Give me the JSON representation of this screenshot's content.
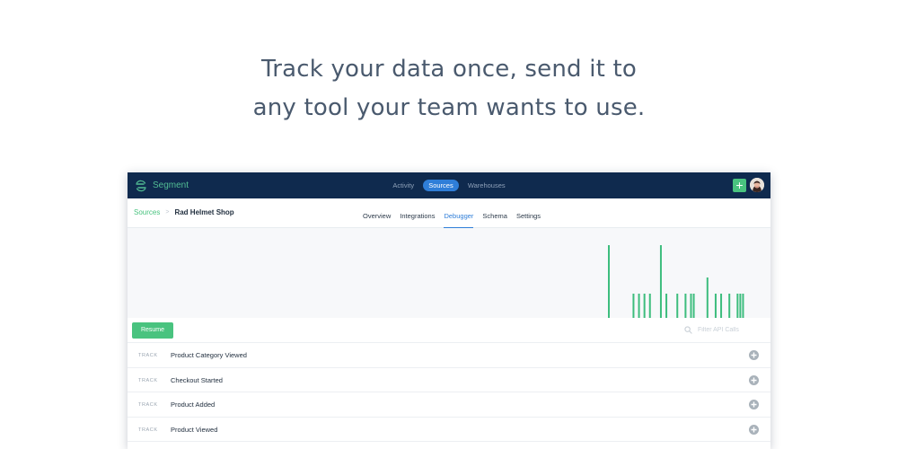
{
  "headline": {
    "line1": "Track your data once, send it to",
    "line2": "any tool your team wants to use."
  },
  "topbar": {
    "logo_text": "Segment",
    "nav": [
      {
        "label": "Activity",
        "active": false
      },
      {
        "label": "Sources",
        "active": true
      },
      {
        "label": "Warehouses",
        "active": false
      }
    ],
    "add_label": "+"
  },
  "breadcrumb": {
    "parent": "Sources",
    "current": "Rad Helmet Shop"
  },
  "tabs": [
    {
      "label": "Overview",
      "active": false
    },
    {
      "label": "Integrations",
      "active": false
    },
    {
      "label": "Debugger",
      "active": true
    },
    {
      "label": "Schema",
      "active": false
    },
    {
      "label": "Settings",
      "active": false
    }
  ],
  "chart_data": {
    "type": "bar",
    "title": "",
    "values": [
      9,
      0,
      0,
      0,
      0,
      0,
      0,
      0,
      0,
      3,
      0,
      3,
      0,
      3,
      0,
      3,
      0,
      0,
      0,
      9,
      0,
      3,
      0,
      0,
      0,
      3,
      0,
      0,
      3,
      0,
      3,
      3,
      0,
      0,
      0,
      0,
      5,
      0,
      0,
      3,
      0,
      3,
      0,
      0,
      3,
      0,
      0,
      3,
      3,
      3,
      0
    ],
    "ylim": [
      0,
      10
    ],
    "color": "#3dbd7d"
  },
  "controls": {
    "resume_label": "Resume",
    "filter_placeholder": "Filter API Calls"
  },
  "events": [
    {
      "type": "TRACK",
      "name": "Product Category Viewed"
    },
    {
      "type": "TRACK",
      "name": "Checkout Started"
    },
    {
      "type": "TRACK",
      "name": "Product Added"
    },
    {
      "type": "TRACK",
      "name": "Product Viewed"
    }
  ],
  "colors": {
    "navbar": "#0f2a4e",
    "accent_green": "#49c37f",
    "active_blue": "#2f7ed8"
  }
}
